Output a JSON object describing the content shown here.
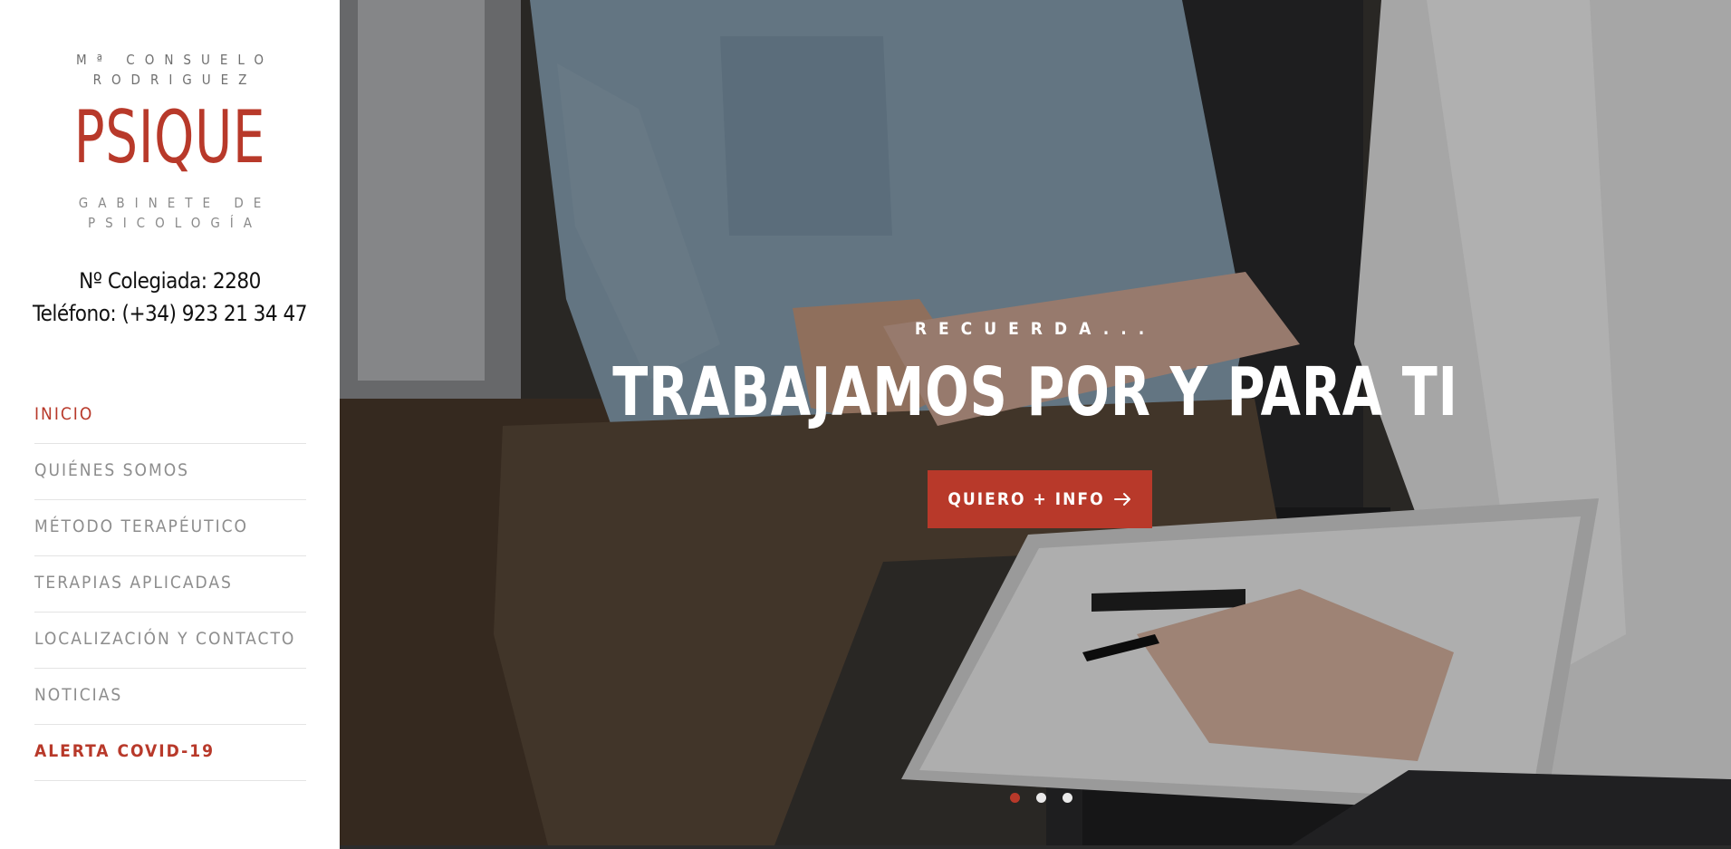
{
  "sidebar": {
    "brand": {
      "owner": "Mª CONSUELO RODRIGUEZ",
      "name": "PSIQUE",
      "tagline": "GABINETE DE PSICOLOGÍA"
    },
    "contact": {
      "registration": "Nº Colegiada: 2280",
      "phone": "Teléfono: (+34) 923 21 34 47"
    },
    "nav": [
      {
        "label": "INICIO",
        "state": "active"
      },
      {
        "label": "QUIÉNES SOMOS",
        "state": "default"
      },
      {
        "label": "MÉTODO TERAPÉUTICO",
        "state": "default"
      },
      {
        "label": "TERAPIAS APLICADAS",
        "state": "default"
      },
      {
        "label": "LOCALIZACIÓN Y CONTACTO",
        "state": "default"
      },
      {
        "label": "NOTICIAS",
        "state": "default"
      },
      {
        "label": "ALERTA COVID-19",
        "state": "highlight"
      }
    ]
  },
  "hero": {
    "kicker": "RECUERDA...",
    "title": "TRABAJAMOS POR Y PARA TI",
    "cta_label": "QUIERO + INFO",
    "cta_icon": "arrow-right-icon",
    "slides": {
      "count": 3,
      "active_index": 0
    }
  },
  "colors": {
    "accent": "#b8392a",
    "nav_text": "#8d8d8d",
    "white": "#ffffff"
  }
}
